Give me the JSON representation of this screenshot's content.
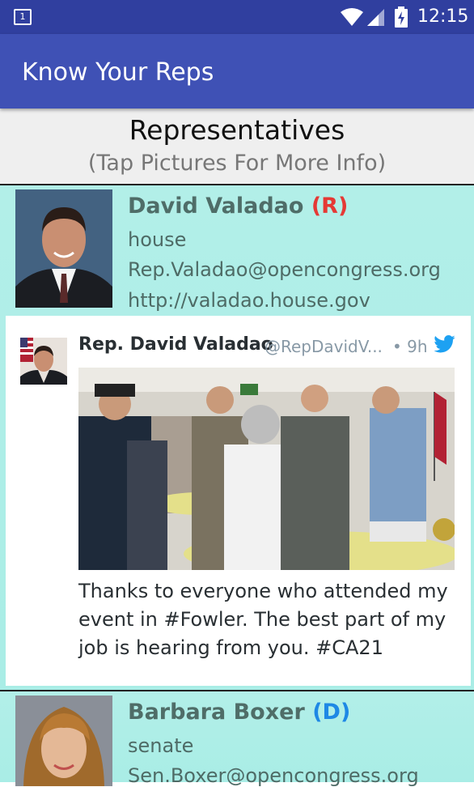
{
  "status_bar": {
    "notification_badge": "1",
    "time": "12:15",
    "icons": [
      "notification-icon",
      "wifi-icon",
      "signal-icon",
      "battery-charging-icon"
    ]
  },
  "app_bar": {
    "title": "Know Your Reps"
  },
  "header": {
    "title": "Representatives",
    "subtitle": "(Tap Pictures For More Info)"
  },
  "representatives": [
    {
      "name": "David Valadao",
      "party": "(R)",
      "chamber": "house",
      "email": "Rep.Valadao@opencongress.org",
      "website": "http://valadao.house.gov",
      "party_color": "#e53935",
      "tweet": {
        "author": "Rep. David Valadao",
        "handle": "@RepDavidV...",
        "time": "• 9h",
        "text": "Thanks to everyone who attended my event in #Fowler. The best part of my job is hearing from you. #CA21"
      }
    },
    {
      "name": "Barbara Boxer",
      "party": "(D)",
      "chamber": "senate",
      "email": "Sen.Boxer@opencongress.org",
      "party_color": "#1e88e5"
    }
  ],
  "colors": {
    "status_bar": "#303f9f",
    "app_bar": "#3f51b5",
    "card_bg": "#b2efe8",
    "twitter_blue": "#1da1f2"
  }
}
